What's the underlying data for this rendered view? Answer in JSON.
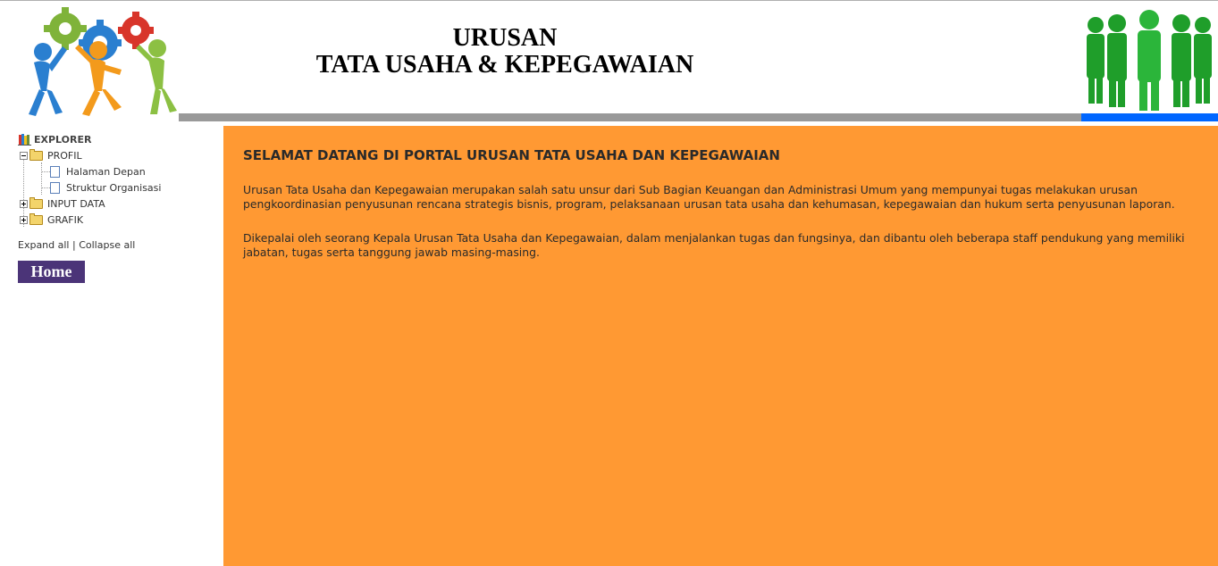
{
  "header": {
    "title_line1": "URUSAN",
    "title_line2": "TATA USAHA & KEPEGAWAIAN"
  },
  "sidebar": {
    "root_label": "EXPLORER",
    "tree": [
      {
        "label": "PROFIL",
        "expanded": true,
        "children": [
          "Halaman Depan",
          "Struktur Organisasi"
        ]
      },
      {
        "label": "INPUT DATA",
        "expanded": false
      },
      {
        "label": "GRAFIK",
        "expanded": false
      }
    ],
    "expand_all": "Expand all",
    "separator": "|",
    "collapse_all": "Collapse all",
    "home_label": "Home"
  },
  "main": {
    "heading": "SELAMAT DATANG DI PORTAL URUSAN TATA USAHA DAN KEPEGAWAIAN",
    "paragraph1": "Urusan Tata Usaha dan Kepegawaian merupakan salah satu unsur dari Sub Bagian Keuangan dan Administrasi Umum yang mempunyai tugas melakukan urusan pengkoordinasian penyusunan rencana strategis bisnis, program, pelaksanaan urusan tata usaha dan kehumasan, kepegawaian dan hukum serta penyusunan laporan.",
    "paragraph2": "Dikepalai oleh seorang Kepala Urusan Tata Usaha dan Kepegawaian, dalam menjalankan tugas dan fungsinya, dan dibantu oleh beberapa staff pendukung yang memiliki jabatan, tugas serta tanggung jawab masing-masing."
  },
  "colors": {
    "content_bg": "#ff9933",
    "gray_bar": "#999999",
    "blue_bar": "#0066ff",
    "home_button": "#4b3478"
  },
  "icons": [
    "gears-people-logo",
    "green-people-logo",
    "book-icon",
    "folder-icon",
    "page-icon",
    "plus-icon",
    "minus-icon"
  ]
}
